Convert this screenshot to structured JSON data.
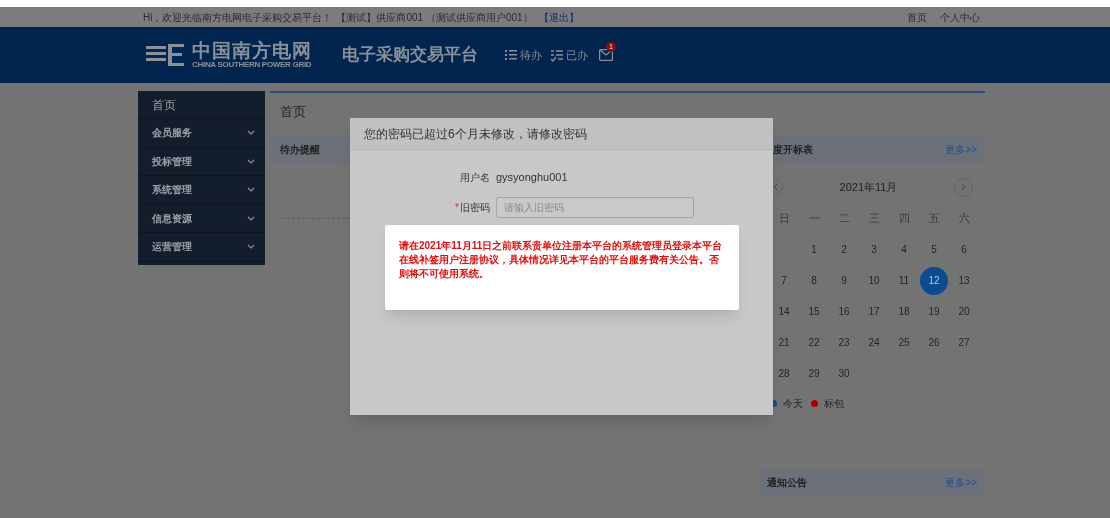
{
  "top_bar": {
    "greeting": "Hi，欢迎光临南方电网电子采购交易平台！",
    "user": "【测试】供应商001 （测试供应商用户001）",
    "logout": "【退出】",
    "links": [
      "首页",
      "个人中心"
    ]
  },
  "header": {
    "logo_cn": "中国南方电网",
    "logo_en": "CHINA SOUTHERN POWER GRID",
    "platform_title": "电子采购交易平台",
    "nav": [
      {
        "kind": "todo",
        "label": "待办"
      },
      {
        "kind": "done",
        "label": "已办"
      }
    ],
    "mail_badge": "1"
  },
  "sidebar": {
    "home": "首页",
    "items": [
      {
        "label": "会员服务",
        "expanded": false
      },
      {
        "label": "投标管理",
        "expanded": false
      },
      {
        "label": "系统管理",
        "expanded": false
      },
      {
        "label": "信息资源",
        "expanded": false
      },
      {
        "label": "运营管理",
        "expanded": false
      }
    ]
  },
  "main": {
    "title": "首页",
    "todo_panel": {
      "title": "待办提醒"
    }
  },
  "schedule_panel": {
    "title": "度开标表",
    "more": "更多>>",
    "calendar": {
      "month": "2021年11月",
      "weekdays": [
        "日",
        "一",
        "二",
        "三",
        "四",
        "五",
        "六"
      ],
      "weeks": [
        [
          {
            "day": "1",
            "selected": false
          },
          {
            "day": "2",
            "selected": false
          },
          {
            "day": "3",
            "selected": false
          },
          {
            "day": "4",
            "selected": false
          },
          {
            "day": "5",
            "selected": false
          },
          {
            "day": "6",
            "selected": false
          }
        ],
        [
          {
            "day": "7",
            "selected": false
          },
          {
            "day": "8",
            "selected": false
          },
          {
            "day": "9",
            "selected": false
          },
          {
            "day": "10",
            "selected": false
          },
          {
            "day": "11",
            "selected": false
          },
          {
            "day": "12",
            "selected": true
          },
          {
            "day": "13",
            "selected": false
          }
        ],
        [
          {
            "day": "14",
            "selected": false
          },
          {
            "day": "15",
            "selected": false
          },
          {
            "day": "16",
            "selected": false
          },
          {
            "day": "17",
            "selected": false
          },
          {
            "day": "18",
            "selected": false
          },
          {
            "day": "19",
            "selected": false
          },
          {
            "day": "20",
            "selected": false
          }
        ],
        [
          {
            "day": "21",
            "selected": false
          },
          {
            "day": "22",
            "selected": false
          },
          {
            "day": "23",
            "selected": false
          },
          {
            "day": "24",
            "selected": false
          },
          {
            "day": "25",
            "selected": false
          },
          {
            "day": "26",
            "selected": false
          },
          {
            "day": "27",
            "selected": false
          }
        ],
        [
          {
            "day": "28",
            "selected": false
          },
          {
            "day": "29",
            "selected": false
          },
          {
            "day": "30",
            "selected": false
          }
        ]
      ],
      "legend": [
        {
          "label": "今天",
          "color": "#0b4f95"
        },
        {
          "label": "标包",
          "color": "#a80000"
        }
      ]
    }
  },
  "notice_panel": {
    "title": "通知公告",
    "more": "更多>>"
  },
  "dialog": {
    "title": "您的密码已超过6个月未修改，请修改密码",
    "fields": [
      {
        "kind": "text",
        "label": "用户名",
        "value": "gysyonghu001"
      },
      {
        "kind": "input",
        "label": "旧密码",
        "required_mark": "*",
        "placeholder": "请输入旧密码"
      }
    ]
  },
  "alert": {
    "message": "请在2021年11月11日之前联系贵单位注册本平台的系统管理员登录本平台在线补签用户注册协议，具体情况详见本平台的平台服务费有关公告。否则将不可使用系统。"
  }
}
